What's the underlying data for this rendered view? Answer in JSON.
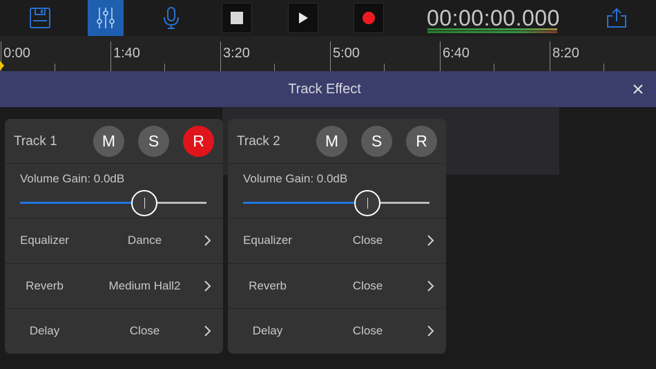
{
  "toolbar": {
    "timecode": "00:00:00.000",
    "icons": {
      "save": "save-icon",
      "mixer": "mixer-icon",
      "mic": "microphone-icon",
      "stop": "stop-icon",
      "play": "play-icon",
      "record": "record-icon",
      "share": "share-icon"
    }
  },
  "ruler": {
    "labels": [
      "0:00",
      "1:40",
      "3:20",
      "5:00",
      "6:40",
      "8:20"
    ]
  },
  "effect": {
    "title": "Track Effect"
  },
  "colors": {
    "accent": "#1f5fb0",
    "record": "#e0141b",
    "header": "#3b3d6b",
    "slider_fill": "#1e78e0"
  },
  "tracks": [
    {
      "name": "Track 1",
      "mute": "M",
      "solo": "S",
      "record": "R",
      "record_active": true,
      "volume_label": "Volume Gain: 0.0dB",
      "volume_level": 0.667,
      "equalizer_label": "Equalizer",
      "equalizer_value": "Dance",
      "reverb_label": "Reverb",
      "reverb_value": "Medium Hall2",
      "delay_label": "Delay",
      "delay_value": "Close"
    },
    {
      "name": "Track 2",
      "mute": "M",
      "solo": "S",
      "record": "R",
      "record_active": false,
      "volume_label": "Volume Gain: 0.0dB",
      "volume_level": 0.667,
      "equalizer_label": "Equalizer",
      "equalizer_value": "Close",
      "reverb_label": "Reverb",
      "reverb_value": "Close",
      "delay_label": "Delay",
      "delay_value": "Close"
    }
  ]
}
